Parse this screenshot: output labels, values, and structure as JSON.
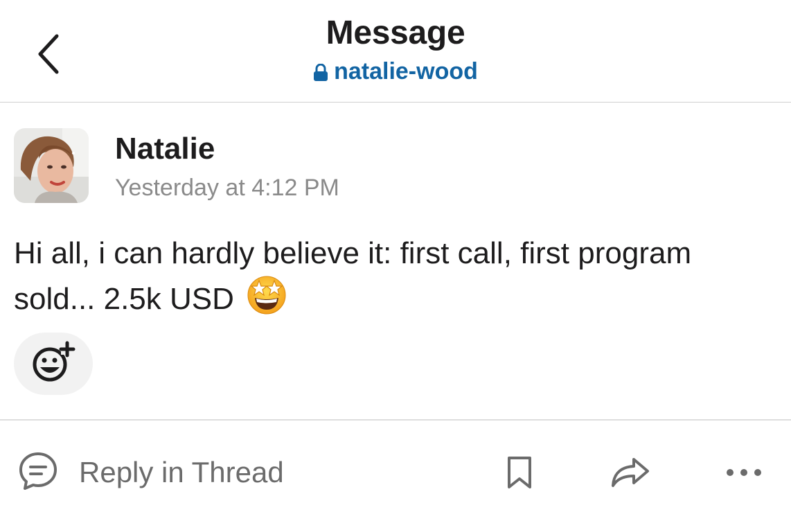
{
  "header": {
    "title": "Message",
    "channel": "natalie-wood",
    "back_icon": "chevron-left-icon",
    "lock_icon": "lock-icon"
  },
  "message": {
    "author": "Natalie",
    "timestamp": "Yesterday at 4:12 PM",
    "text": "Hi all, i can hardly believe it: first call, first program sold... 2.5k USD",
    "emoji": "star-struck-emoji"
  },
  "reactions": {
    "add_reaction_icon": "add-reaction-icon"
  },
  "actions": {
    "reply_label": "Reply in Thread",
    "reply_icon": "comment-icon",
    "save_icon": "bookmark-icon",
    "share_icon": "share-arrow-icon",
    "more_icon": "more-horizontal-icon"
  },
  "colors": {
    "link": "#1264a3",
    "text": "#1d1c1d",
    "muted": "#8a8a8a",
    "reaction_bg": "#f2f2f2"
  }
}
